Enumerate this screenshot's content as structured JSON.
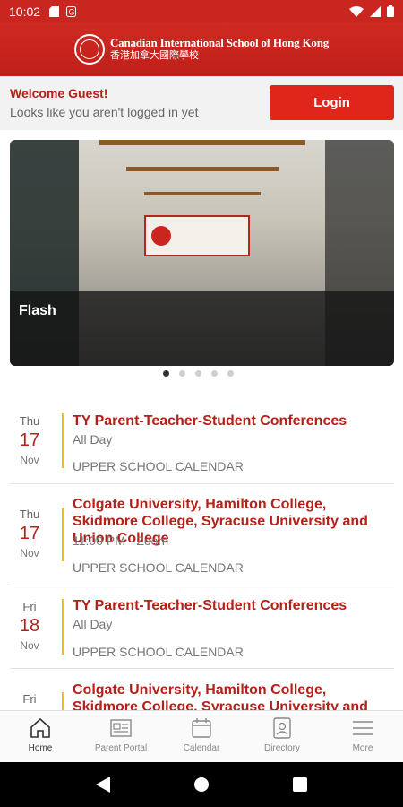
{
  "status_bar": {
    "time": "10:02"
  },
  "header": {
    "school_name_en": "Canadian International School of Hong Kong",
    "school_name_zh": "香港加拿大國際學校"
  },
  "welcome": {
    "title": "Welcome Guest!",
    "subtitle": "Looks like you aren't logged in yet",
    "login_label": "Login"
  },
  "hero": {
    "caption": "Flash",
    "slides": 5,
    "active_slide": 1
  },
  "events": [
    {
      "dow": "Thu",
      "day": "17",
      "month": "Nov",
      "title": "TY Parent-Teacher-Student Conferences",
      "time": "All Day",
      "calendar": "UPPER SCHOOL CALENDAR"
    },
    {
      "dow": "Thu",
      "day": "17",
      "month": "Nov",
      "title": "Colgate University, Hamilton College, Skidmore College, Syracuse University and Union College",
      "time": "11:00 PM · Zoom",
      "calendar": "UPPER SCHOOL CALENDAR"
    },
    {
      "dow": "Fri",
      "day": "18",
      "month": "Nov",
      "title": "TY Parent-Teacher-Student Conferences",
      "time": "All Day",
      "calendar": "UPPER SCHOOL CALENDAR"
    },
    {
      "dow": "Fri",
      "day": "",
      "month": "",
      "title": "Colgate University, Hamilton College, Skidmore College, Syracuse University and Union College",
      "time": "",
      "calendar": ""
    }
  ],
  "bottom_nav": [
    {
      "label": "Home",
      "icon": "home-icon",
      "active": true
    },
    {
      "label": "Parent Portal",
      "icon": "newspaper-icon",
      "active": false
    },
    {
      "label": "Calendar",
      "icon": "calendar-icon",
      "active": false
    },
    {
      "label": "Directory",
      "icon": "contact-card-icon",
      "active": false
    },
    {
      "label": "More",
      "icon": "menu-icon",
      "active": false
    }
  ],
  "colors": {
    "brand": "#c9261f",
    "accent_bar": "#f0bc1c",
    "login": "#e0261b"
  }
}
